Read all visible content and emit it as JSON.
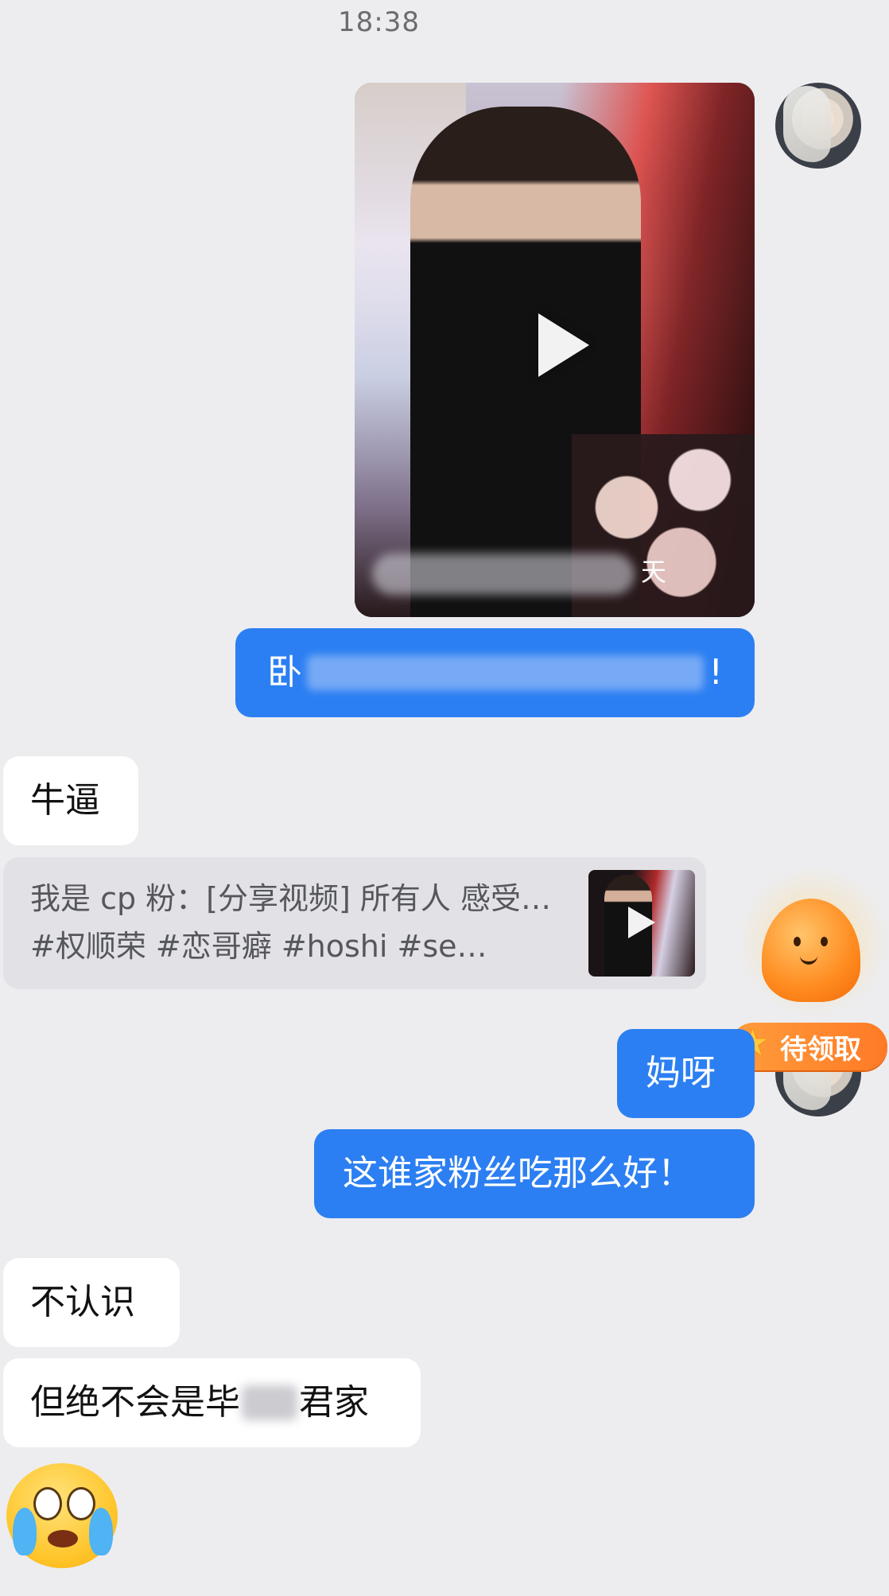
{
  "status_bar": {
    "time": "18:38"
  },
  "messages": {
    "sent_video": {
      "caption_visible_tail": "天",
      "caption_prefix": "卧",
      "caption_suffix": "!"
    },
    "received_1": "牛逼",
    "share_card": {
      "text": "我是 cp 粉：[分享视频] 所有人 感受… #权顺荣 #恋哥癖 #hoshi #se…"
    },
    "mascot_badge": "待领取",
    "sent_2": "妈呀",
    "sent_3": "这谁家粉丝吃那么好！",
    "received_2": "不认识",
    "received_3": {
      "prefix": "但绝不会是毕",
      "suffix": "君家"
    }
  },
  "icons": {
    "play": "play-icon",
    "emoji": "crying-laughing-emoji",
    "mascot": "flame-mascot-icon",
    "star": "star-icon"
  },
  "colors": {
    "background": "#ededf0",
    "sent_bubble": "#2c7ff2",
    "received_bubble": "#ffffff",
    "badge": "#ff8a2e"
  }
}
